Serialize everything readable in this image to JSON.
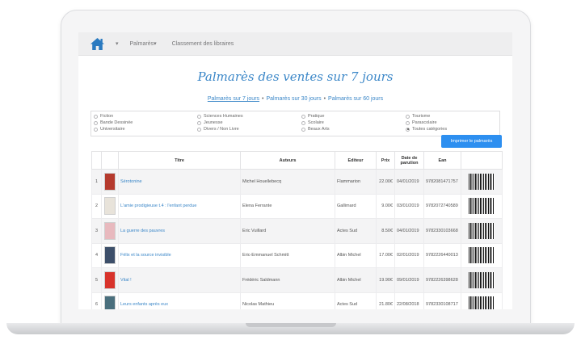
{
  "nav": {
    "caret": "▾",
    "links": [
      "Palmarès▾",
      "Classement des libraires"
    ]
  },
  "page": {
    "title": "Palmarès des ventes sur 7 jours",
    "periods": [
      "Palmarès sur 7 jours",
      "Palmarès sur 30 jours",
      "Palmarès sur 60 jours"
    ],
    "separator": "•"
  },
  "categories": [
    {
      "label": "Fiction",
      "checked": false
    },
    {
      "label": "Bande Dessinée",
      "checked": false
    },
    {
      "label": "Universitaire",
      "checked": false
    },
    {
      "label": "Sciences Humaines",
      "checked": false
    },
    {
      "label": "Jeunesse",
      "checked": false
    },
    {
      "label": "Divers / Non Livre",
      "checked": false
    },
    {
      "label": "Pratique",
      "checked": false
    },
    {
      "label": "Scolaire",
      "checked": false
    },
    {
      "label": "Beaux Arts",
      "checked": false
    },
    {
      "label": "Tourisme",
      "checked": false
    },
    {
      "label": "Parascolaire",
      "checked": false
    },
    {
      "label": "Toutes catégories",
      "checked": true
    }
  ],
  "print_button": "Imprimer le palmarès",
  "table": {
    "headers": {
      "title": "Titre",
      "authors": "Auteurs",
      "publisher": "Editeur",
      "price": "Prix",
      "date": "Date de parution",
      "ean": "Ean"
    },
    "rows": [
      {
        "rank": "1",
        "title": "Sérotonine",
        "author": "Michel Houellebecq",
        "publisher": "Flammarion",
        "price": "22.00€",
        "date": "04/01/2019",
        "ean": "9782081471757",
        "cover_color": "#b53a2d"
      },
      {
        "rank": "2",
        "title": "L'amie prodigieuse t.4 : l'enfant perdue",
        "author": "Elena Ferrante",
        "publisher": "Gallimard",
        "price": "9.00€",
        "date": "03/01/2019",
        "ean": "9782072740589",
        "cover_color": "#e8e3da"
      },
      {
        "rank": "3",
        "title": "La guerre des pauvres",
        "author": "Eric Vuillard",
        "publisher": "Actes Sud",
        "price": "8.50€",
        "date": "04/01/2019",
        "ean": "9782330103668",
        "cover_color": "#e8b9be"
      },
      {
        "rank": "4",
        "title": "Félix et la source invisible",
        "author": "Eric-Emmanuel Schmitt",
        "publisher": "Albin Michel",
        "price": "17.00€",
        "date": "02/01/2019",
        "ean": "9782226440013",
        "cover_color": "#3d4f6a"
      },
      {
        "rank": "5",
        "title": "Vital !",
        "author": "Frédéric Saldmann",
        "publisher": "Albin Michel",
        "price": "19.90€",
        "date": "09/01/2019",
        "ean": "9782226398628",
        "cover_color": "#d8332b"
      },
      {
        "rank": "6",
        "title": "Leurs enfants après eux",
        "author": "Nicolas Mathieu",
        "publisher": "Actes Sud",
        "price": "21.80€",
        "date": "22/08/2018",
        "ean": "9782330108717",
        "cover_color": "#4a6f7d"
      }
    ]
  }
}
